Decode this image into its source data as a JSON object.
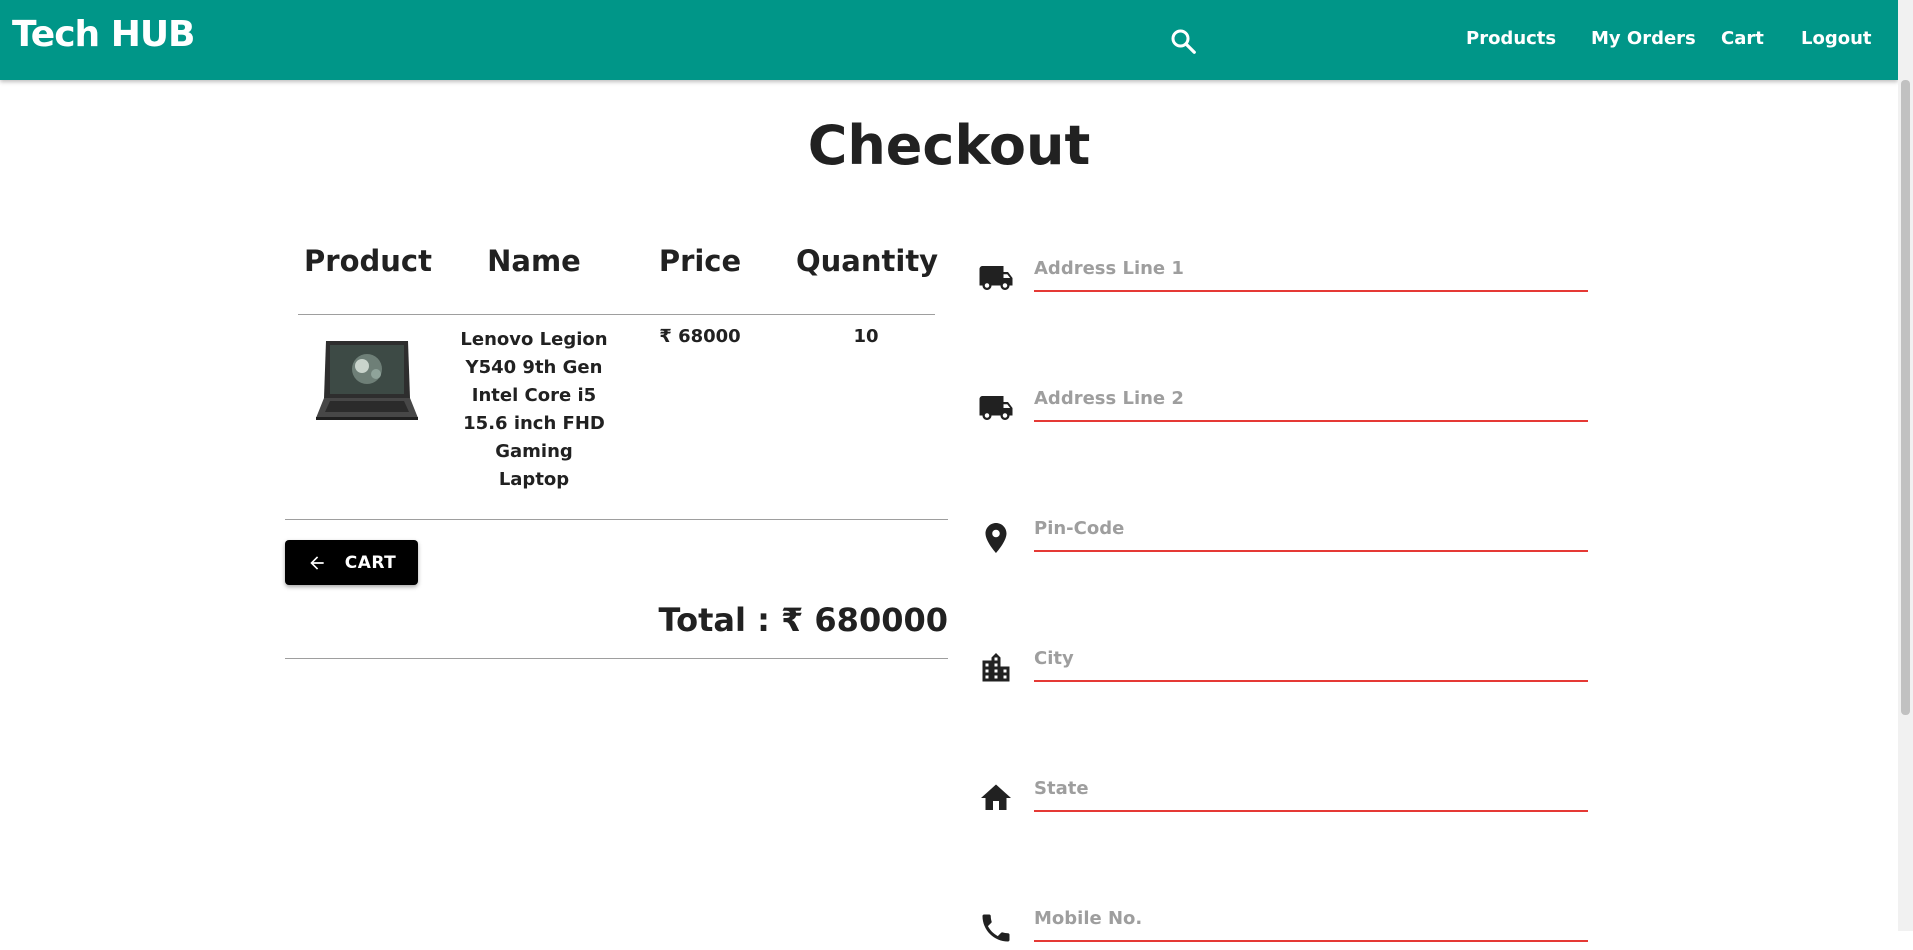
{
  "header": {
    "brand": "Tech HUB",
    "search_icon": "search-icon",
    "nav": [
      {
        "label": "Products"
      },
      {
        "label": "My Orders"
      },
      {
        "label": "Cart"
      },
      {
        "label": "Logout"
      }
    ]
  },
  "colors": {
    "appbar": "#009688",
    "field_underline": "#e53935",
    "button": "#000000"
  },
  "page_title": "Checkout",
  "order_table": {
    "columns": [
      "Product",
      "Name",
      "Price",
      "Quantity"
    ],
    "rows": [
      {
        "image_icon": "laptop-image",
        "name": "Lenovo Legion Y540 9th Gen Intel Core i5 15.6 inch FHD Gaming Laptop",
        "price": "₹ 68000",
        "quantity": "10"
      }
    ]
  },
  "cart_button": {
    "label": "CART",
    "icon": "arrow-left-icon"
  },
  "total": "Total : ₹ 680000",
  "address_form": {
    "fields": [
      {
        "placeholder": "Address Line 1",
        "value": "",
        "icon": "truck-icon"
      },
      {
        "placeholder": "Address Line 2",
        "value": "",
        "icon": "truck-icon"
      },
      {
        "placeholder": "Pin-Code",
        "value": "",
        "icon": "location-pin-icon"
      },
      {
        "placeholder": "City",
        "value": "",
        "icon": "city-icon"
      },
      {
        "placeholder": "State",
        "value": "",
        "icon": "home-icon"
      },
      {
        "placeholder": "Mobile No.",
        "value": "",
        "icon": "phone-icon"
      }
    ]
  }
}
